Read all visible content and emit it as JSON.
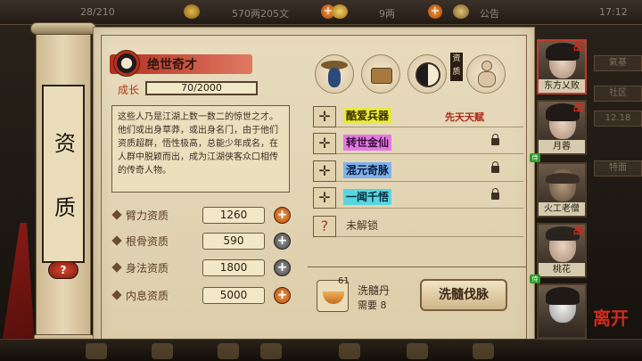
{
  "topbar": {
    "capacity": "28/210",
    "money": "570两205文",
    "ingot": "9两",
    "announce": "公告",
    "time": "17:12"
  },
  "side_title": [
    "资",
    "质"
  ],
  "help_symbol": "?",
  "talent": {
    "name": "绝世奇才",
    "growth_label": "成长",
    "growth_value": "70/2000",
    "description": "这些人乃是江湖上数一数二的惊世之才。他们或出身草莽，或出身名门，由于他们资质超群，悟性极高，总能少年成名，在人群中脱颖而出，成为江湖侠客众口相传的传奇人物。"
  },
  "stats": [
    {
      "label": "臂力资质",
      "value": "1260",
      "btn": "+",
      "btn_color": "orange"
    },
    {
      "label": "根骨资质",
      "value": "590",
      "btn": "+",
      "btn_color": "grey"
    },
    {
      "label": "身法资质",
      "value": "1800",
      "btn": "+",
      "btn_color": "grey"
    },
    {
      "label": "内息资质",
      "value": "5000",
      "btn": "+",
      "btn_color": "orange"
    }
  ],
  "top_icons": [
    "straw-hat-figure-icon",
    "basket-icon",
    "yin-yang-icon",
    "muscle-figure-icon"
  ],
  "vertical_tag": "资质",
  "skills": [
    {
      "symbol": "✛",
      "name": "酷爱兵器",
      "highlight": "#e8ea3c",
      "note": "先天天赋",
      "locked": false
    },
    {
      "symbol": "✛",
      "name": "转世金仙",
      "highlight": "#e07ae0",
      "note": "",
      "locked": true
    },
    {
      "symbol": "✛",
      "name": "混元奇脉",
      "highlight": "#7fb2ee",
      "note": "",
      "locked": true
    },
    {
      "symbol": "✛",
      "name": "一闻千悟",
      "highlight": "#58d6e0",
      "note": "",
      "locked": true
    },
    {
      "symbol": "?",
      "name": "未解锁",
      "highlight": "",
      "note": "",
      "locked": false
    }
  ],
  "pill": {
    "count": "61",
    "name": "洗髓丹",
    "need_label": "需要",
    "need_value": "8",
    "button": "洗髓伐脉"
  },
  "heroes": [
    {
      "name": "东方乂败",
      "flag": "战",
      "selected": true
    },
    {
      "name": "月蓉",
      "flag": "战",
      "selected": false
    },
    {
      "name": "火工老僧",
      "flag": "",
      "selected": false
    },
    {
      "name": "桃花",
      "flag": "战",
      "selected": false
    },
    {
      "name": "",
      "flag": "",
      "selected": false
    }
  ],
  "seat_badge": "侍",
  "edge_stubs": [
    "氣基",
    "社区",
    "12.18",
    "特面"
  ],
  "exit_label": "离开"
}
